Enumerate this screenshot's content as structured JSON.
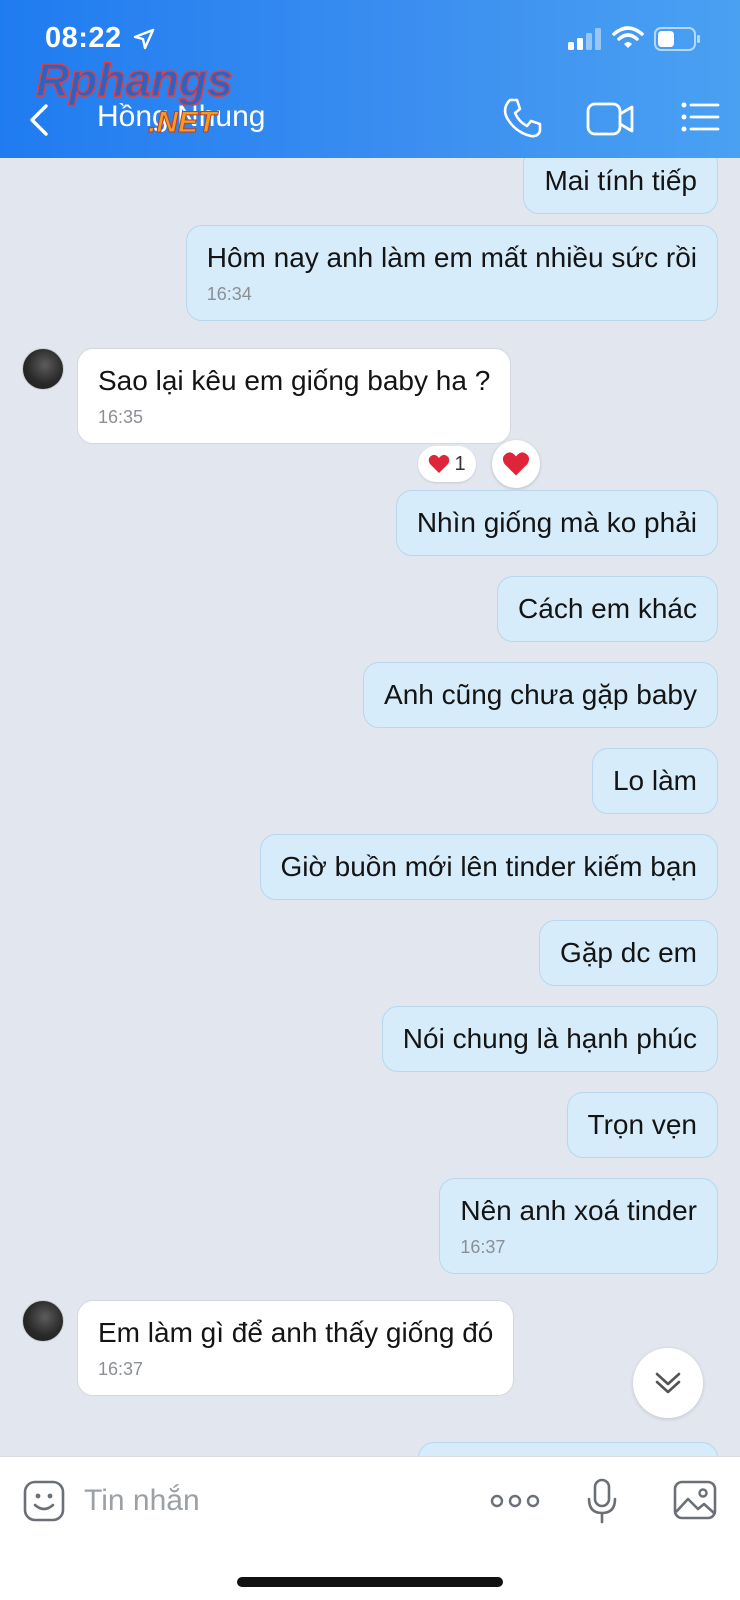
{
  "status_bar": {
    "time": "08:22"
  },
  "header": {
    "contact_name": "Hồng Nhung",
    "watermark_logo": "Rphangs.NET"
  },
  "messages": [
    {
      "direction": "out",
      "text": "Mai tính tiếp",
      "time": ""
    },
    {
      "direction": "out",
      "text": "Hôm nay anh làm em mất nhiều sức rồi",
      "time": "16:34"
    },
    {
      "direction": "in",
      "text": "Sao lại kêu em giống baby ha ?",
      "time": "16:35",
      "reaction": {
        "emoji": "❤️",
        "count": "1"
      }
    },
    {
      "direction": "out",
      "text": "Nhìn giống mà ko phải",
      "time": ""
    },
    {
      "direction": "out",
      "text": "Cách em khác",
      "time": ""
    },
    {
      "direction": "out",
      "text": "Anh cũng chưa gặp baby",
      "time": ""
    },
    {
      "direction": "out",
      "text": "Lo làm",
      "time": ""
    },
    {
      "direction": "out",
      "text": "Giờ buồn mới lên tinder kiếm bạn",
      "time": ""
    },
    {
      "direction": "out",
      "text": "Gặp dc em",
      "time": ""
    },
    {
      "direction": "out",
      "text": "Nói chung là hạnh phúc",
      "time": ""
    },
    {
      "direction": "out",
      "text": "Trọn vẹn",
      "time": ""
    },
    {
      "direction": "out",
      "text": "Nên anh xoá tinder",
      "time": "16:37"
    },
    {
      "direction": "in",
      "text": "Em làm gì để anh thấy giống đó",
      "time": "16:37"
    }
  ],
  "composer": {
    "placeholder": "Tin nhắn"
  },
  "colors": {
    "header_gradient_start": "#1f7cf0",
    "header_gradient_end": "#4aa1f2",
    "outgoing_bubble": "#d6ecfb",
    "incoming_bubble": "#ffffff",
    "chat_background": "#e2e7ef"
  },
  "icons": [
    "location-arrow-icon",
    "signal-icon",
    "wifi-icon",
    "battery-icon",
    "back-chevron-icon",
    "phone-icon",
    "video-camera-icon",
    "list-menu-icon",
    "heart-icon",
    "chevron-double-down-icon",
    "sticker-icon",
    "more-dots-icon",
    "microphone-icon",
    "image-icon"
  ]
}
